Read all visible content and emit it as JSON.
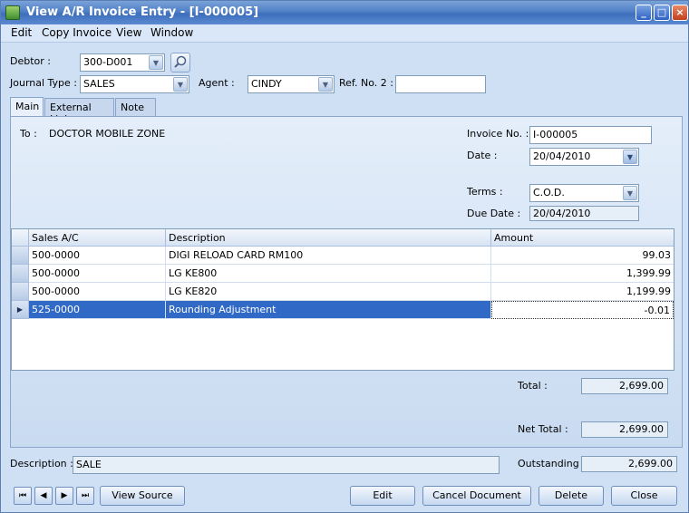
{
  "window": {
    "title": "View A/R Invoice Entry - [I-000005]",
    "controls": [
      "_",
      "□",
      "×"
    ]
  },
  "menu": [
    "Edit",
    "Copy Invoice",
    "View",
    "Window"
  ],
  "header": {
    "debtor_label": "Debtor :",
    "debtor_value": "300-D001",
    "journal_type_label": "Journal Type :",
    "journal_type_value": "SALES",
    "agent_label": "Agent :",
    "agent_value": "CINDY",
    "ref_no2_label": "Ref. No. 2 :",
    "ref_no2_value": ""
  },
  "tabs": [
    "Main",
    "External Links",
    "Note"
  ],
  "main": {
    "to_label": "To :",
    "to_value": "DOCTOR MOBILE ZONE",
    "invoice_no_label": "Invoice No. :",
    "invoice_no_value": "I-000005",
    "date_label": "Date :",
    "date_value": "20/04/2010",
    "terms_label": "Terms :",
    "terms_value": "C.O.D.",
    "due_date_label": "Due Date :",
    "due_date_value": "20/04/2010"
  },
  "grid": {
    "columns": [
      "Sales A/C",
      "Description",
      "Amount"
    ],
    "rows": [
      {
        "account": "500-0000",
        "description": "DIGI RELOAD CARD RM100",
        "amount": "99.03"
      },
      {
        "account": "500-0000",
        "description": "LG KE800",
        "amount": "1,399.99"
      },
      {
        "account": "500-0000",
        "description": "LG KE820",
        "amount": "1,199.99"
      },
      {
        "account": "525-0000",
        "description": "Rounding Adjustment",
        "amount": "-0.01"
      }
    ],
    "selected_row_marker": "▶"
  },
  "totals": {
    "total_label": "Total :",
    "total_value": "2,699.00",
    "net_total_label": "Net Total :",
    "net_total_value": "2,699.00"
  },
  "footer": {
    "description_label": "Description :",
    "description_value": "SALE",
    "outstanding_label": "Outstanding :",
    "outstanding_value": "2,699.00"
  },
  "nav_buttons": [
    "⏮",
    "◀",
    "▶",
    "⏭"
  ],
  "buttons": {
    "view_source": "View Source",
    "edit": "Edit",
    "cancel_document": "Cancel Document",
    "delete": "Delete",
    "close": "Close"
  },
  "colors": {
    "selection": "#3169c6",
    "title_bar": "#4f7fc6",
    "panel": "#cfe0f4"
  }
}
